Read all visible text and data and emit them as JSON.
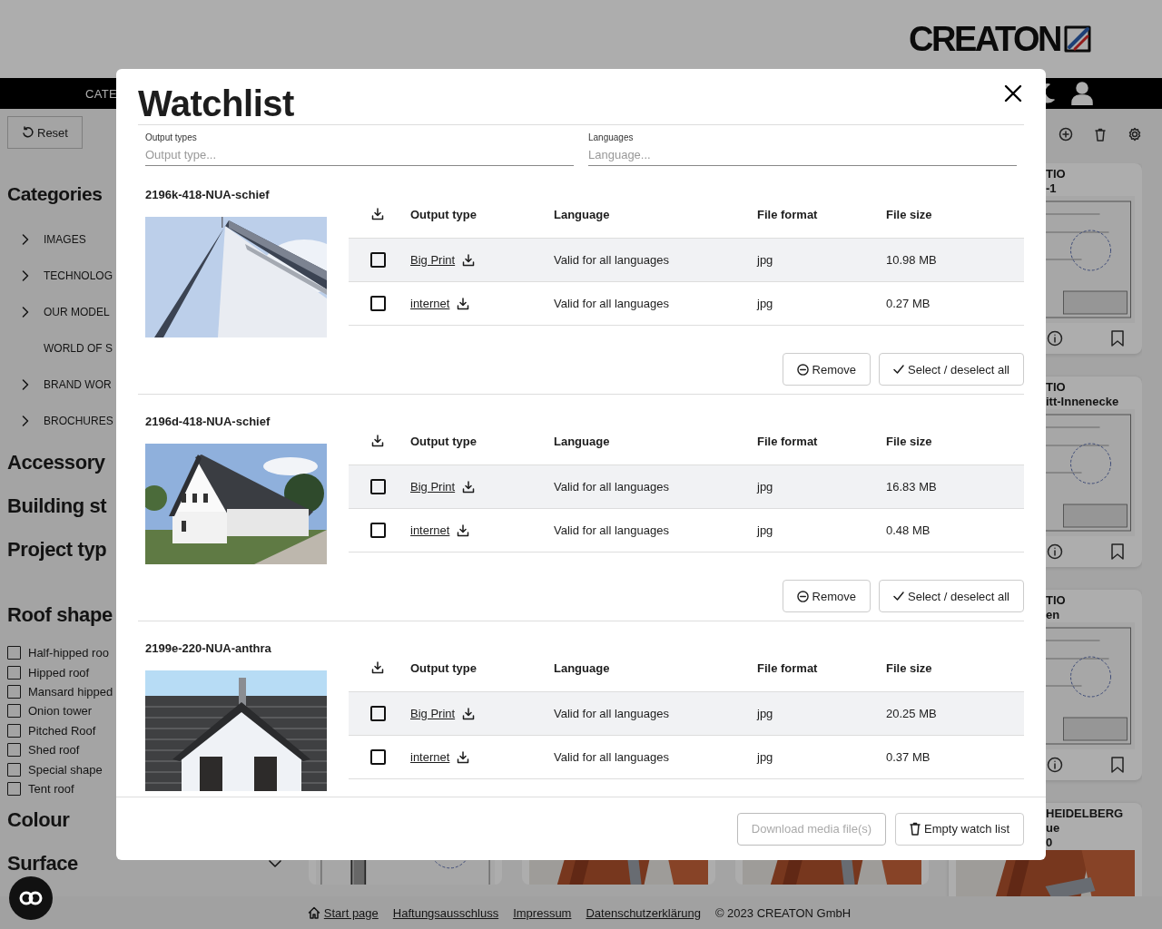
{
  "header": {
    "logo": "CREATON"
  },
  "nav": {
    "label": "CATE"
  },
  "sidebar": {
    "reset": "Reset",
    "categories_title": "Categories",
    "categories": [
      {
        "label": "IMAGES",
        "expandable": true
      },
      {
        "label": "TECHNOLOG",
        "expandable": true
      },
      {
        "label": "OUR MODEL",
        "expandable": true
      },
      {
        "label": "WORLD OF S",
        "expandable": false
      },
      {
        "label": "BRAND WOR",
        "expandable": true
      },
      {
        "label": "BROCHURES",
        "expandable": true
      }
    ],
    "sections": [
      {
        "label": "Accessory"
      },
      {
        "label": "Building st"
      },
      {
        "label": "Project typ"
      }
    ],
    "roof_shape": {
      "title": "Roof shape",
      "options": [
        {
          "label": "Half-hipped roo",
          "checked": false
        },
        {
          "label": "Hipped roof",
          "checked": false
        },
        {
          "label": "Mansard hipped",
          "checked": false
        },
        {
          "label": "Onion tower",
          "checked": false
        },
        {
          "label": "Pitched Roof",
          "checked": false
        },
        {
          "label": "Shed roof",
          "checked": false
        },
        {
          "label": "Special shape",
          "checked": false
        },
        {
          "label": "Tent roof",
          "checked": false
        }
      ]
    },
    "more_sections": [
      {
        "label": "Colour"
      },
      {
        "label": "Surface",
        "expandable": true
      }
    ]
  },
  "result_cards": [
    {
      "title_lines": [
        "TIO",
        "-1"
      ]
    },
    {
      "title_lines": [
        "TIO",
        "itt-Innenecke"
      ]
    },
    {
      "title_lines": [
        "TIO",
        "en"
      ]
    },
    {
      "title_lines": [
        "HEIDELBERG",
        "ue",
        "0"
      ]
    }
  ],
  "footer": {
    "links": [
      "Start page",
      "Haftungsausschluss",
      "Impressum",
      "Datenschutzerklärung"
    ],
    "copyright": "© 2023 CREATON GmbH"
  },
  "watchlist": {
    "title": "Watchlist",
    "filters": [
      {
        "label": "Output types",
        "placeholder": "Output type..."
      },
      {
        "label": "Languages",
        "placeholder": "Language..."
      }
    ],
    "groups": [
      {
        "name": "2196k-418-NUA-schief",
        "columns": [
          "Output type",
          "Language",
          "File format",
          "File size"
        ],
        "rows": [
          {
            "output_type": "Big Print",
            "language": "Valid for all languages",
            "format": "jpg",
            "size": "10.98 MB",
            "checked": false
          },
          {
            "output_type": "internet",
            "language": "Valid for all languages",
            "format": "jpg",
            "size": "0.27 MB",
            "checked": false
          }
        ],
        "actions": [
          {
            "kind": "remove",
            "label": "Remove"
          },
          {
            "kind": "select_all",
            "label": "Select / deselect all"
          }
        ]
      },
      {
        "name": "2196d-418-NUA-schief",
        "columns": [
          "Output type",
          "Language",
          "File format",
          "File size"
        ],
        "rows": [
          {
            "output_type": "Big Print",
            "language": "Valid for all languages",
            "format": "jpg",
            "size": "16.83 MB",
            "checked": false
          },
          {
            "output_type": "internet",
            "language": "Valid for all languages",
            "format": "jpg",
            "size": "0.48 MB",
            "checked": false
          }
        ],
        "actions": [
          {
            "kind": "remove",
            "label": "Remove"
          },
          {
            "kind": "select_all",
            "label": "Select / deselect all"
          }
        ]
      },
      {
        "name": "2199e-220-NUA-anthra",
        "columns": [
          "Output type",
          "Language",
          "File format",
          "File size"
        ],
        "rows": [
          {
            "output_type": "Big Print",
            "language": "Valid for all languages",
            "format": "jpg",
            "size": "20.25 MB",
            "checked": false
          },
          {
            "output_type": "internet",
            "language": "Valid for all languages",
            "format": "jpg",
            "size": "0.37 MB",
            "checked": false
          }
        ]
      }
    ],
    "buttons": [
      {
        "kind": "download",
        "label": "Download media file(s)",
        "disabled": true
      },
      {
        "kind": "empty",
        "label": "Empty watch list",
        "disabled": false
      }
    ]
  }
}
